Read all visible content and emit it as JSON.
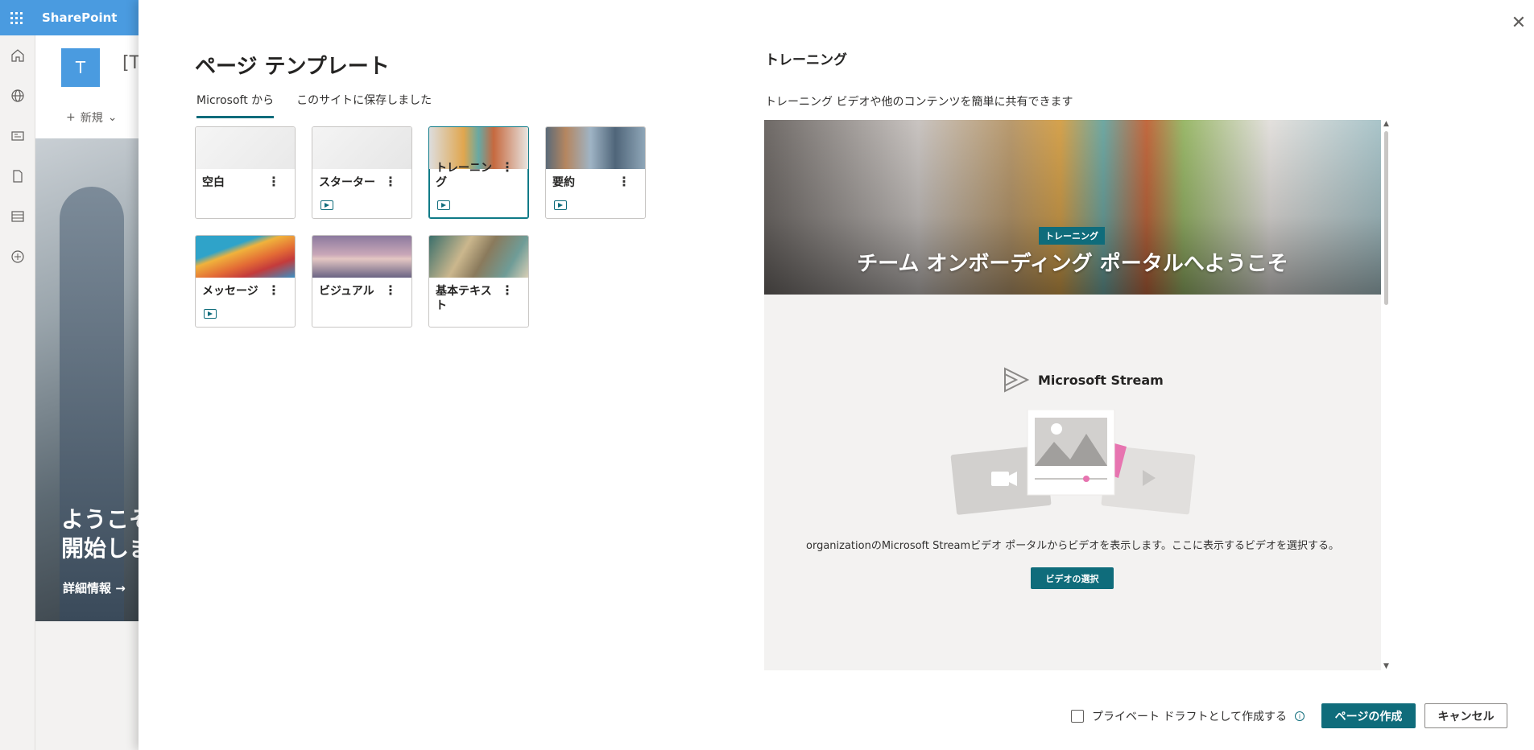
{
  "app": {
    "name": "SharePoint"
  },
  "site": {
    "logo_letter": "T",
    "name_partial": "[T",
    "new_label": "新規"
  },
  "hero": {
    "title": "ようこそ\n開始しま",
    "more": "詳細情報 →"
  },
  "panel": {
    "title": "ページ テンプレート",
    "tabs": [
      {
        "label": "Microsoft から",
        "active": true
      },
      {
        "label": "このサイトに保存しました",
        "active": false
      }
    ],
    "templates": [
      {
        "label": "空白",
        "video": false,
        "selected": false
      },
      {
        "label": "スターター",
        "video": true,
        "selected": false
      },
      {
        "label": "トレーニング",
        "video": true,
        "selected": true
      },
      {
        "label": "要約",
        "video": true,
        "selected": false
      },
      {
        "label": "メッセージ",
        "video": true,
        "selected": false
      },
      {
        "label": "ビジュアル",
        "video": false,
        "selected": false
      },
      {
        "label": "基本テキスト",
        "video": false,
        "selected": false
      }
    ]
  },
  "preview": {
    "title": "トレーニング",
    "description": "トレーニング ビデオや他のコンテンツを簡単に共有できます",
    "tag": "トレーニング",
    "heading": "チーム オンボーディング ポータルへようこそ",
    "stream_name": "Microsoft Stream",
    "info": "organizationのMicrosoft Streamビデオ ポータルからビデオを表示します。ここに表示するビデオを選択する。",
    "select_button": "ビデオの選択"
  },
  "footer": {
    "draft_label": "プライベート ドラフトとして作成する",
    "draft_checked": false,
    "create_button": "ページの作成",
    "cancel_button": "キャンセル"
  },
  "colors": {
    "accent": "#0f6c7b",
    "suitebar": "#4a9be0"
  }
}
